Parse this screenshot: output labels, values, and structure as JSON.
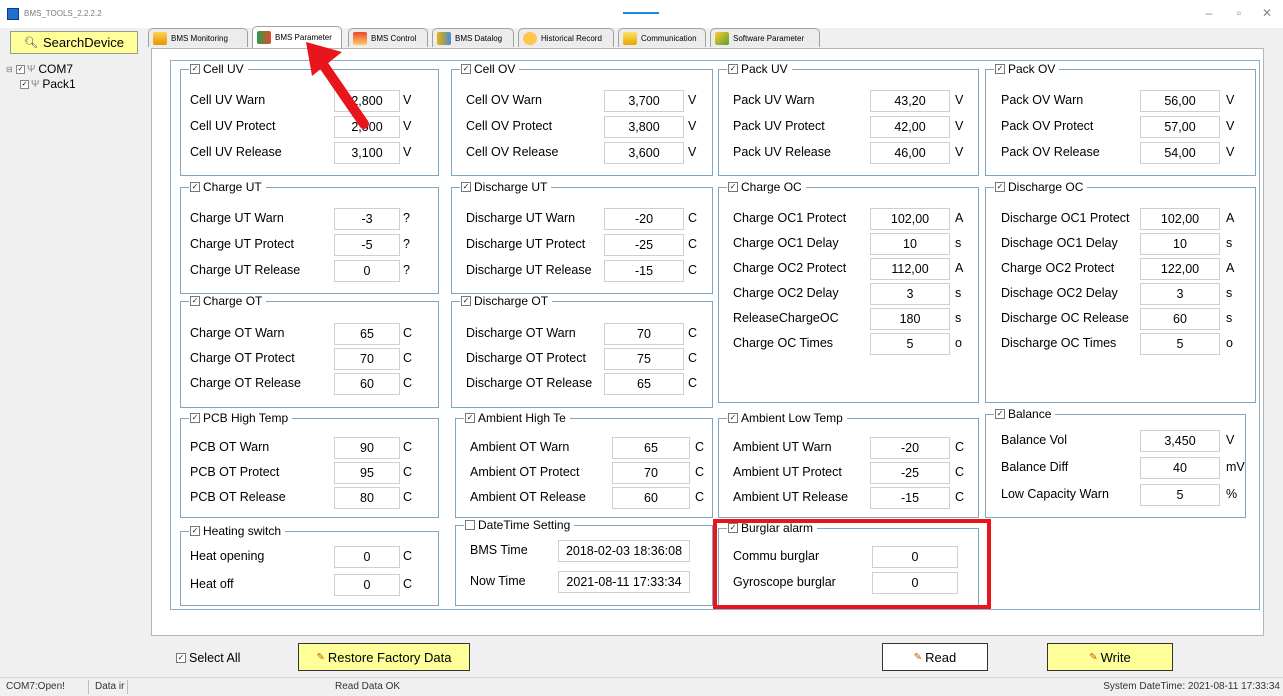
{
  "app": {
    "title": "BMS_TOOLS_2.2.2.2"
  },
  "colors": {
    "search_bg": "#ffff99",
    "highlight_red": "#e8161c",
    "group_border": "#7fa6c0",
    "tab_active": "#ffffff"
  },
  "sidebar": {
    "search_label": "SearchDevice",
    "search_icon": "magnifier-icon",
    "tree": [
      {
        "label": "COM7",
        "checked": true
      },
      {
        "label": "Pack1",
        "checked": true
      }
    ]
  },
  "tabs": [
    {
      "label": "BMS Monitoring",
      "icon": "monitor-icon",
      "active": false
    },
    {
      "label": "BMS Parameter",
      "icon": "parameter-icon",
      "active": true
    },
    {
      "label": "BMS Control",
      "icon": "home-icon",
      "active": false
    },
    {
      "label": "BMS Datalog",
      "icon": "datalog-icon",
      "active": false
    },
    {
      "label": "Historical Record",
      "icon": "history-icon",
      "active": false
    },
    {
      "label": "Communication",
      "icon": "communication-icon",
      "active": false
    },
    {
      "label": "Software Parameter",
      "icon": "software-icon",
      "active": false
    }
  ],
  "groups": {
    "cell_uv": {
      "title": "Cell UV",
      "checked": true,
      "rows": [
        {
          "label": "Cell UV Warn",
          "value": "2,800",
          "unit": "V"
        },
        {
          "label": "Cell UV Protect",
          "value": "2,500",
          "unit": "V"
        },
        {
          "label": "Cell UV Release",
          "value": "3,100",
          "unit": "V"
        }
      ]
    },
    "cell_ov": {
      "title": "Cell OV",
      "checked": true,
      "rows": [
        {
          "label": "Cell OV Warn",
          "value": "3,700",
          "unit": "V"
        },
        {
          "label": "Cell OV Protect",
          "value": "3,800",
          "unit": "V"
        },
        {
          "label": "Cell OV Release",
          "value": "3,600",
          "unit": "V"
        }
      ]
    },
    "pack_uv": {
      "title": "Pack UV",
      "checked": true,
      "rows": [
        {
          "label": "Pack UV Warn",
          "value": "43,20",
          "unit": "V"
        },
        {
          "label": "Pack UV Protect",
          "value": "42,00",
          "unit": "V"
        },
        {
          "label": "Pack UV Release",
          "value": "46,00",
          "unit": "V"
        }
      ]
    },
    "pack_ov": {
      "title": "Pack OV",
      "checked": true,
      "rows": [
        {
          "label": "Pack OV Warn",
          "value": "56,00",
          "unit": "V"
        },
        {
          "label": "Pack OV Protect",
          "value": "57,00",
          "unit": "V"
        },
        {
          "label": "Pack OV Release",
          "value": "54,00",
          "unit": "V"
        }
      ]
    },
    "charge_ut": {
      "title": "Charge UT",
      "checked": true,
      "rows": [
        {
          "label": "Charge UT Warn",
          "value": "-3",
          "unit": "?"
        },
        {
          "label": "Charge UT Protect",
          "value": "-5",
          "unit": "?"
        },
        {
          "label": "Charge UT Release",
          "value": "0",
          "unit": "?"
        }
      ]
    },
    "discharge_ut": {
      "title": "Discharge UT",
      "checked": true,
      "rows": [
        {
          "label": "Discharge UT Warn",
          "value": "-20",
          "unit": "C"
        },
        {
          "label": "Discharge UT Protect",
          "value": "-25",
          "unit": "C"
        },
        {
          "label": "Discharge UT Release",
          "value": "-15",
          "unit": "C"
        }
      ]
    },
    "charge_oc": {
      "title": "Charge OC",
      "checked": true,
      "rows": [
        {
          "label": "Charge OC1 Protect",
          "value": "102,00",
          "unit": "A"
        },
        {
          "label": "Charge OC1 Delay",
          "value": "10",
          "unit": "s"
        },
        {
          "label": "Charge OC2 Protect",
          "value": "112,00",
          "unit": "A"
        },
        {
          "label": "Charge OC2 Delay",
          "value": "3",
          "unit": "s"
        },
        {
          "label": "ReleaseChargeOC",
          "value": "180",
          "unit": "s"
        },
        {
          "label": "Charge OC Times",
          "value": "5",
          "unit": "o"
        }
      ]
    },
    "discharge_oc": {
      "title": "Discharge OC",
      "checked": true,
      "rows": [
        {
          "label": "Discharge OC1 Protect",
          "value": "102,00",
          "unit": "A"
        },
        {
          "label": "Dischage OC1 Delay",
          "value": "10",
          "unit": "s"
        },
        {
          "label": "Charge OC2 Protect",
          "value": "122,00",
          "unit": "A"
        },
        {
          "label": "Dischage OC2 Delay",
          "value": "3",
          "unit": "s"
        },
        {
          "label": "Discharge OC Release",
          "value": "60",
          "unit": "s"
        },
        {
          "label": "Discharge OC Times",
          "value": "5",
          "unit": "o"
        }
      ]
    },
    "charge_ot": {
      "title": "Charge OT",
      "checked": true,
      "rows": [
        {
          "label": "Charge OT Warn",
          "value": "65",
          "unit": "C"
        },
        {
          "label": "Charge OT Protect",
          "value": "70",
          "unit": "C"
        },
        {
          "label": "Charge OT Release",
          "value": "60",
          "unit": "C"
        }
      ]
    },
    "discharge_ot": {
      "title": "Discharge OT",
      "checked": true,
      "rows": [
        {
          "label": "Discharge OT Warn",
          "value": "70",
          "unit": "C"
        },
        {
          "label": "Discharge OT Protect",
          "value": "75",
          "unit": "C"
        },
        {
          "label": "Discharge OT Release",
          "value": "65",
          "unit": "C"
        }
      ]
    },
    "pcb_high_temp": {
      "title": "PCB High Temp",
      "checked": true,
      "rows": [
        {
          "label": "PCB OT Warn",
          "value": "90",
          "unit": "C"
        },
        {
          "label": "PCB OT Protect",
          "value": "95",
          "unit": "C"
        },
        {
          "label": "PCB OT Release",
          "value": "80",
          "unit": "C"
        }
      ]
    },
    "ambient_high_temp": {
      "title": "Ambient High Te",
      "checked": true,
      "rows": [
        {
          "label": "Ambient OT Warn",
          "value": "65",
          "unit": "C"
        },
        {
          "label": "Ambient OT Protect",
          "value": "70",
          "unit": "C"
        },
        {
          "label": "Ambient OT Release",
          "value": "60",
          "unit": "C"
        }
      ]
    },
    "ambient_low_temp": {
      "title": "Ambient Low Temp",
      "checked": true,
      "rows": [
        {
          "label": "Ambient UT Warn",
          "value": "-20",
          "unit": "C"
        },
        {
          "label": "Ambient UT Protect",
          "value": "-25",
          "unit": "C"
        },
        {
          "label": "Ambient UT Release",
          "value": "-15",
          "unit": "C"
        }
      ]
    },
    "balance": {
      "title": "Balance",
      "checked": true,
      "rows": [
        {
          "label": "Balance Vol",
          "value": "3,450",
          "unit": "V"
        },
        {
          "label": "Balance Diff",
          "value": "40",
          "unit": "mV"
        },
        {
          "label": "Low Capacity Warn",
          "value": "5",
          "unit": "%"
        }
      ]
    },
    "heating_switch": {
      "title": "Heating switch",
      "checked": true,
      "rows": [
        {
          "label": "Heat opening",
          "value": "0",
          "unit": "C"
        },
        {
          "label": "Heat off",
          "value": "0",
          "unit": "C"
        }
      ]
    },
    "datetime_setting": {
      "title": "DateTime Setting",
      "checked": false,
      "rows": [
        {
          "label": "BMS Time",
          "value": "2018-02-03 18:36:08"
        },
        {
          "label": "Now Time",
          "value": "2021-08-11 17:33:34"
        }
      ]
    },
    "burglar_alarm": {
      "title": "Burglar alarm",
      "checked": true,
      "rows": [
        {
          "label": "Commu burglar",
          "value": "0"
        },
        {
          "label": "Gyroscope burglar",
          "value": "0"
        }
      ]
    }
  },
  "footer": {
    "select_all": "Select All",
    "select_all_checked": true,
    "restore": "Restore Factory Data",
    "read": "Read",
    "write": "Write"
  },
  "status": {
    "port": "COM7:Open!",
    "data": "Data ir",
    "message": "Read Data OK",
    "datetime": "System DateTime: 2021-08-11 17:33:34"
  }
}
